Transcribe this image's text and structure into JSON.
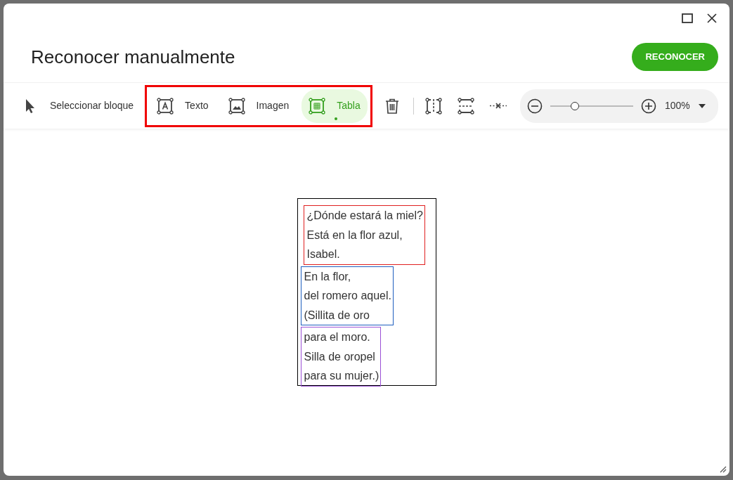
{
  "window": {
    "title": "Reconocer manualmente"
  },
  "primary_button": "RECONOCER",
  "tools": [
    {
      "kind": "select",
      "label": "Seleccionar bloque",
      "selected": false
    },
    {
      "kind": "text",
      "label": "Texto",
      "selected": false
    },
    {
      "kind": "image",
      "label": "Imagen",
      "selected": false
    },
    {
      "kind": "table",
      "label": "Tabla",
      "selected": true
    },
    {
      "kind": "delete",
      "selected": false
    },
    {
      "kind": "split-vertical",
      "selected": false
    },
    {
      "kind": "split-horizontal",
      "selected": false
    },
    {
      "kind": "remove-separator",
      "selected": false
    }
  ],
  "zoom": {
    "level": 0.3,
    "value": "100%"
  },
  "blocks": [
    {
      "color": "#e02020",
      "lines": [
        "¿Dónde estará la miel?",
        "Está en la flor azul,",
        "Isabel."
      ]
    },
    {
      "color": "#1f5fbf",
      "lines": [
        "En la flor,",
        "del romero aquel.",
        "(Sillita de oro"
      ]
    },
    {
      "color": "#9b4fd6",
      "lines": [
        "para el moro.",
        "Silla de oropel",
        "para su mujer.)"
      ]
    }
  ]
}
